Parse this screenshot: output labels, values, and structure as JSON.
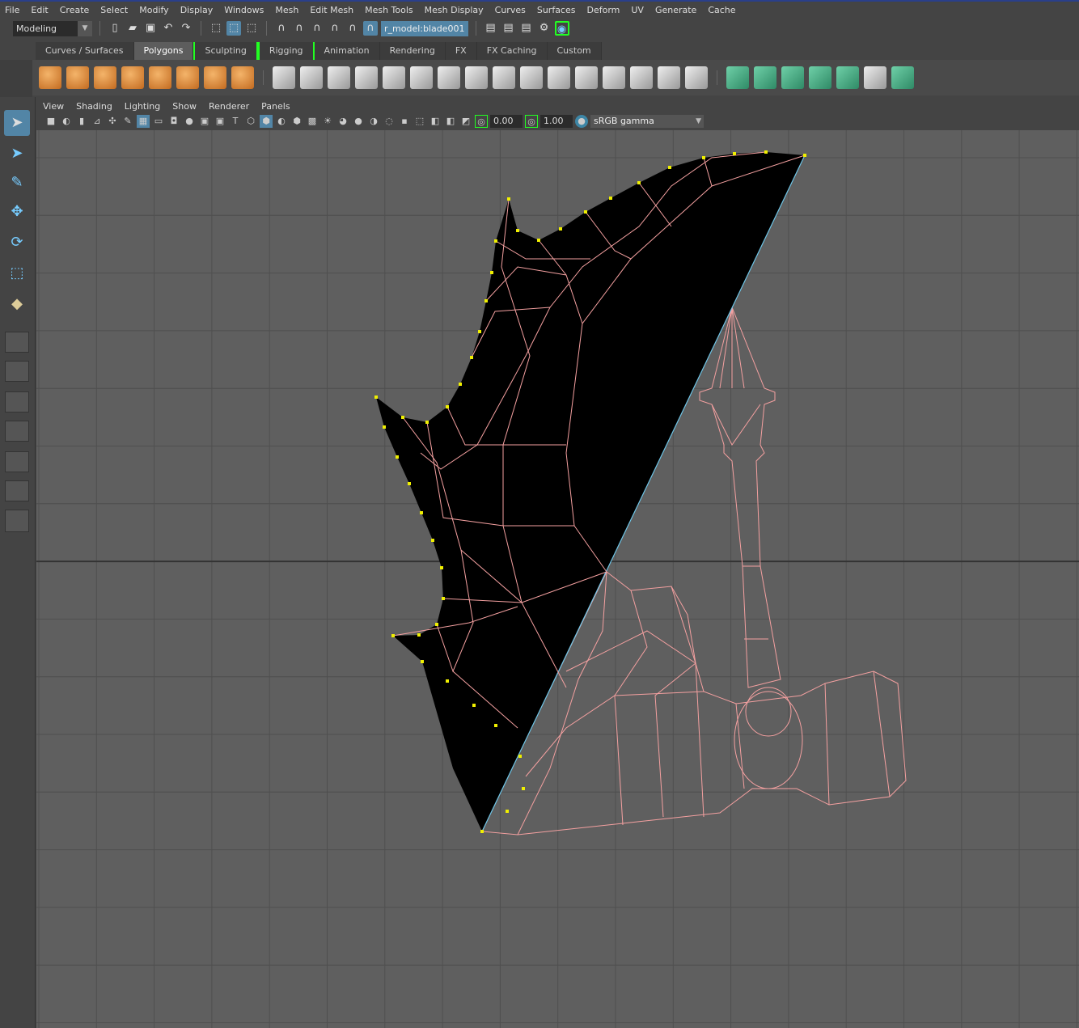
{
  "menubar": [
    "File",
    "Edit",
    "Create",
    "Select",
    "Modify",
    "Display",
    "Windows",
    "Mesh",
    "Edit Mesh",
    "Mesh Tools",
    "Mesh Display",
    "Curves",
    "Surfaces",
    "Deform",
    "UV",
    "Generate",
    "Cache"
  ],
  "status": {
    "mode": "Modeling",
    "object_field": "r_model:blade001"
  },
  "shelf_tabs": [
    "Curves / Surfaces",
    "Polygons",
    "Sculpting",
    "Rigging",
    "Animation",
    "Rendering",
    "FX",
    "FX Caching",
    "Custom"
  ],
  "active_shelf_tab": "Polygons",
  "panel_menu": [
    "View",
    "Shading",
    "Lighting",
    "Show",
    "Renderer",
    "Panels"
  ],
  "panel_toolbar": {
    "exposure": "0.00",
    "gamma": "1.00",
    "color_space": "sRGB gamma"
  },
  "colors": {
    "selection_blue": "#5285a6",
    "wireframe": "#f4a0a0",
    "vertex": "#f0f000",
    "mesh_fill": "#000000",
    "highlight_edge": "#6fc6e8",
    "viewport_bg": "#5f5f5f"
  }
}
